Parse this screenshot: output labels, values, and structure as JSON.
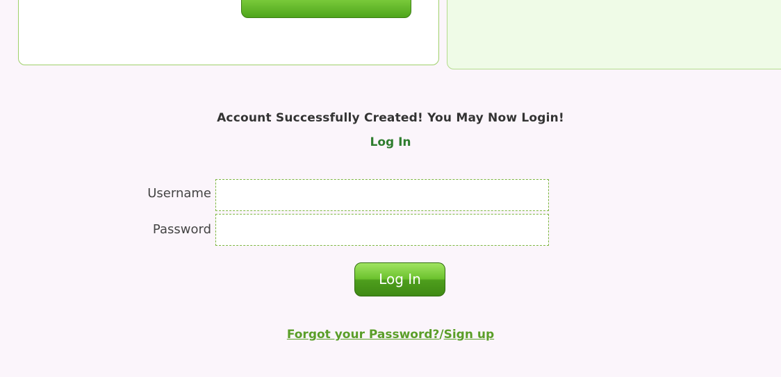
{
  "message": {
    "success": "Account Successfully Created! You May Now Login!",
    "heading": "Log In"
  },
  "form": {
    "username_label": "Username",
    "password_label": "Password",
    "username_value": "",
    "password_value": "",
    "submit_label": "Log In"
  },
  "links": {
    "forgot_password": "Forgot your Password?",
    "separator": "/",
    "sign_up": "Sign up"
  },
  "colors": {
    "page_background": "#fbf5fb",
    "accent_green": "#5a9e28",
    "heading_green": "#2e7d2e"
  }
}
